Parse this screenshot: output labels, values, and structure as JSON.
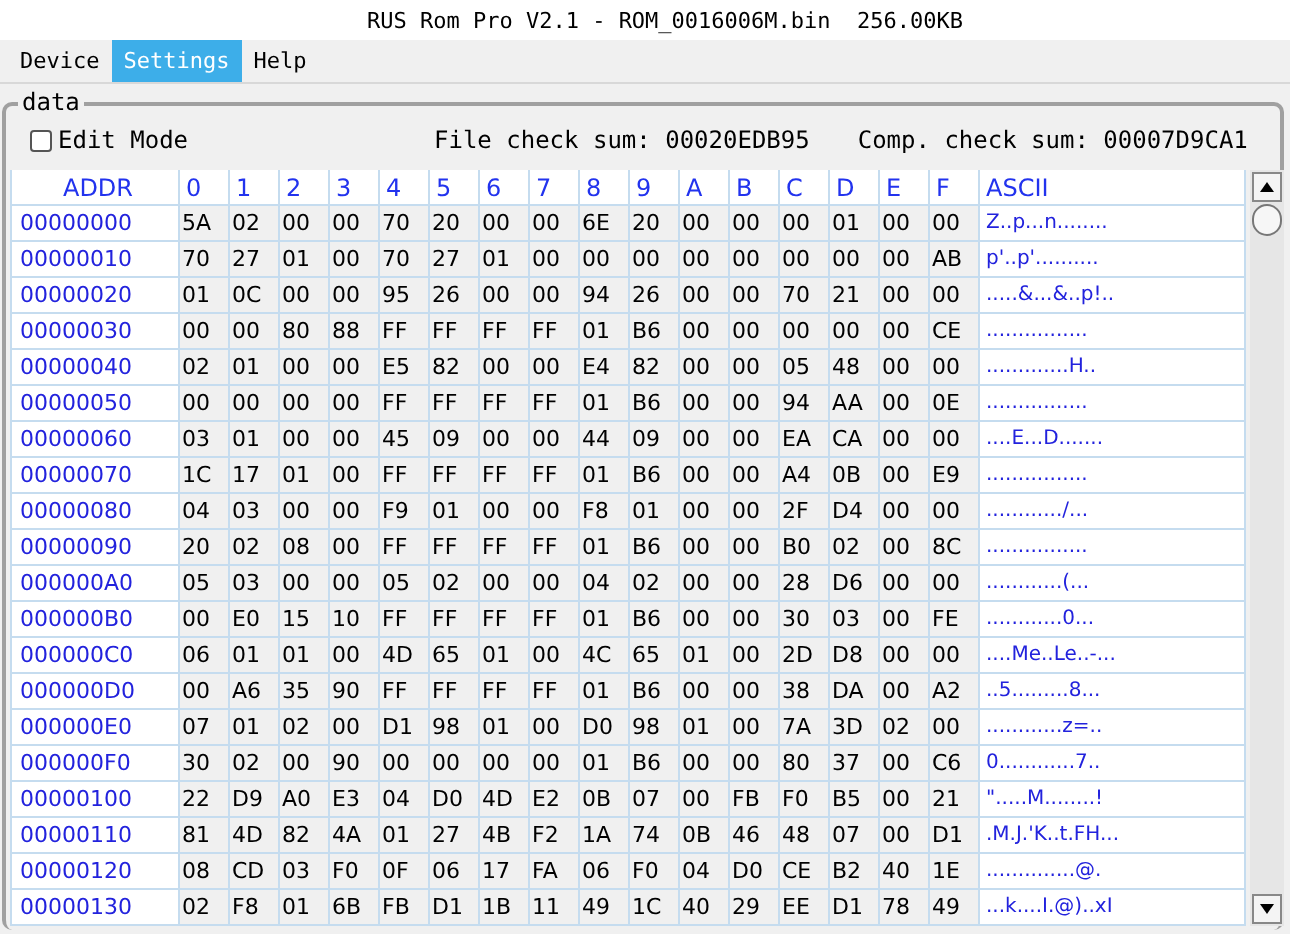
{
  "window": {
    "title": "RUS Rom Pro V2.1 - ROM_0016006M.bin  256.00KB"
  },
  "menu": [
    {
      "label": "Device",
      "selected": false
    },
    {
      "label": "Settings",
      "selected": true
    },
    {
      "label": "Help",
      "selected": false
    }
  ],
  "group": {
    "title": "data"
  },
  "edit_mode": {
    "label": "Edit Mode",
    "checked": false
  },
  "file_checksum": {
    "label": "File check sum:",
    "value": "00020EDB95"
  },
  "comp_checksum": {
    "label": "Comp. check sum:",
    "value": "00007D9CA1"
  },
  "table": {
    "columns": [
      "ADDR",
      "0",
      "1",
      "2",
      "3",
      "4",
      "5",
      "6",
      "7",
      "8",
      "9",
      "A",
      "B",
      "C",
      "D",
      "E",
      "F",
      "ASCII"
    ],
    "rows": [
      {
        "addr": "00000000",
        "bytes": [
          "5A",
          "02",
          "00",
          "00",
          "70",
          "20",
          "00",
          "00",
          "6E",
          "20",
          "00",
          "00",
          "00",
          "01",
          "00",
          "00"
        ],
        "ascii": "Z..p...n........"
      },
      {
        "addr": "00000010",
        "bytes": [
          "70",
          "27",
          "01",
          "00",
          "70",
          "27",
          "01",
          "00",
          "00",
          "00",
          "00",
          "00",
          "00",
          "00",
          "00",
          "AB"
        ],
        "ascii": "p'..p'.........."
      },
      {
        "addr": "00000020",
        "bytes": [
          "01",
          "0C",
          "00",
          "00",
          "95",
          "26",
          "00",
          "00",
          "94",
          "26",
          "00",
          "00",
          "70",
          "21",
          "00",
          "00"
        ],
        "ascii": ".....&...&..p!.."
      },
      {
        "addr": "00000030",
        "bytes": [
          "00",
          "00",
          "80",
          "88",
          "FF",
          "FF",
          "FF",
          "FF",
          "01",
          "B6",
          "00",
          "00",
          "00",
          "00",
          "00",
          "CE"
        ],
        "ascii": "................"
      },
      {
        "addr": "00000040",
        "bytes": [
          "02",
          "01",
          "00",
          "00",
          "E5",
          "82",
          "00",
          "00",
          "E4",
          "82",
          "00",
          "00",
          "05",
          "48",
          "00",
          "00"
        ],
        "ascii": ".............H.."
      },
      {
        "addr": "00000050",
        "bytes": [
          "00",
          "00",
          "00",
          "00",
          "FF",
          "FF",
          "FF",
          "FF",
          "01",
          "B6",
          "00",
          "00",
          "94",
          "AA",
          "00",
          "0E"
        ],
        "ascii": "................"
      },
      {
        "addr": "00000060",
        "bytes": [
          "03",
          "01",
          "00",
          "00",
          "45",
          "09",
          "00",
          "00",
          "44",
          "09",
          "00",
          "00",
          "EA",
          "CA",
          "00",
          "00"
        ],
        "ascii": "....E...D......."
      },
      {
        "addr": "00000070",
        "bytes": [
          "1C",
          "17",
          "01",
          "00",
          "FF",
          "FF",
          "FF",
          "FF",
          "01",
          "B6",
          "00",
          "00",
          "A4",
          "0B",
          "00",
          "E9"
        ],
        "ascii": "................"
      },
      {
        "addr": "00000080",
        "bytes": [
          "04",
          "03",
          "00",
          "00",
          "F9",
          "01",
          "00",
          "00",
          "F8",
          "01",
          "00",
          "00",
          "2F",
          "D4",
          "00",
          "00"
        ],
        "ascii": "............/..."
      },
      {
        "addr": "00000090",
        "bytes": [
          "20",
          "02",
          "08",
          "00",
          "FF",
          "FF",
          "FF",
          "FF",
          "01",
          "B6",
          "00",
          "00",
          "B0",
          "02",
          "00",
          "8C"
        ],
        "ascii": "................"
      },
      {
        "addr": "000000A0",
        "bytes": [
          "05",
          "03",
          "00",
          "00",
          "05",
          "02",
          "00",
          "00",
          "04",
          "02",
          "00",
          "00",
          "28",
          "D6",
          "00",
          "00"
        ],
        "ascii": "............(..."
      },
      {
        "addr": "000000B0",
        "bytes": [
          "00",
          "E0",
          "15",
          "10",
          "FF",
          "FF",
          "FF",
          "FF",
          "01",
          "B6",
          "00",
          "00",
          "30",
          "03",
          "00",
          "FE"
        ],
        "ascii": "............0..."
      },
      {
        "addr": "000000C0",
        "bytes": [
          "06",
          "01",
          "01",
          "00",
          "4D",
          "65",
          "01",
          "00",
          "4C",
          "65",
          "01",
          "00",
          "2D",
          "D8",
          "00",
          "00"
        ],
        "ascii": "....Me..Le..-..."
      },
      {
        "addr": "000000D0",
        "bytes": [
          "00",
          "A6",
          "35",
          "90",
          "FF",
          "FF",
          "FF",
          "FF",
          "01",
          "B6",
          "00",
          "00",
          "38",
          "DA",
          "00",
          "A2"
        ],
        "ascii": "..5.........8..."
      },
      {
        "addr": "000000E0",
        "bytes": [
          "07",
          "01",
          "02",
          "00",
          "D1",
          "98",
          "01",
          "00",
          "D0",
          "98",
          "01",
          "00",
          "7A",
          "3D",
          "02",
          "00"
        ],
        "ascii": "............z=.."
      },
      {
        "addr": "000000F0",
        "bytes": [
          "30",
          "02",
          "00",
          "90",
          "00",
          "00",
          "00",
          "00",
          "01",
          "B6",
          "00",
          "00",
          "80",
          "37",
          "00",
          "C6"
        ],
        "ascii": "0............7.."
      },
      {
        "addr": "00000100",
        "bytes": [
          "22",
          "D9",
          "A0",
          "E3",
          "04",
          "D0",
          "4D",
          "E2",
          "0B",
          "07",
          "00",
          "FB",
          "F0",
          "B5",
          "00",
          "21"
        ],
        "ascii": "\".....M........!"
      },
      {
        "addr": "00000110",
        "bytes": [
          "81",
          "4D",
          "82",
          "4A",
          "01",
          "27",
          "4B",
          "F2",
          "1A",
          "74",
          "0B",
          "46",
          "48",
          "07",
          "00",
          "D1"
        ],
        "ascii": ".M.J.'K..t.FH..."
      },
      {
        "addr": "00000120",
        "bytes": [
          "08",
          "CD",
          "03",
          "F0",
          "0F",
          "06",
          "17",
          "FA",
          "06",
          "F0",
          "04",
          "D0",
          "CE",
          "B2",
          "40",
          "1E"
        ],
        "ascii": "..............@."
      },
      {
        "addr": "00000130",
        "bytes": [
          "02",
          "F8",
          "01",
          "6B",
          "FB",
          "D1",
          "1B",
          "11",
          "49",
          "1C",
          "40",
          "29",
          "EE",
          "D1",
          "78",
          "49"
        ],
        "ascii": "...k....I.@)..xI"
      }
    ]
  }
}
